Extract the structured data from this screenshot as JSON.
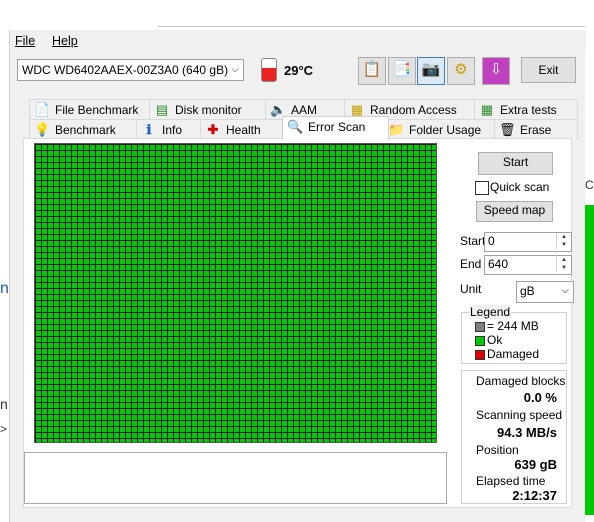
{
  "menu": {
    "file": "File",
    "help": "Help"
  },
  "toolbar": {
    "drive": "WDC WD6402AAEX-00Z3A0 (640 gB)",
    "temperature": "29°C",
    "exit_label": "Exit",
    "buttons": [
      "copy-icon",
      "save-text-icon",
      "camera-icon",
      "tools-icon",
      "download-icon"
    ]
  },
  "tabs_row1": [
    {
      "label": "File Benchmark",
      "icon": "file-info-icon"
    },
    {
      "label": "Disk monitor",
      "icon": "chart-icon"
    },
    {
      "label": "AAM",
      "icon": "speaker-icon"
    },
    {
      "label": "Random Access",
      "icon": "random-grid-icon"
    },
    {
      "label": "Extra tests",
      "icon": "table-icon"
    }
  ],
  "tabs_row2": [
    {
      "label": "Benchmark",
      "icon": "bulb-icon"
    },
    {
      "label": "Info",
      "icon": "info-icon"
    },
    {
      "label": "Health",
      "icon": "health-cross-icon"
    },
    {
      "label": "Error Scan",
      "icon": "magnifier-icon"
    },
    {
      "label": "Folder Usage",
      "icon": "folder-icon"
    },
    {
      "label": "Erase",
      "icon": "trash-icon"
    }
  ],
  "scan": {
    "start_button": "Start",
    "quick_scan_label": "Quick scan",
    "quick_scan_checked": false,
    "speed_map_button": "Speed map",
    "start_label": "Start",
    "start_value": "0",
    "end_label": "End",
    "end_value": "640",
    "unit_label": "Unit",
    "unit_value": "gB",
    "legend": {
      "title": "Legend",
      "block_size": "= 244 MB",
      "ok": "Ok",
      "damaged": "Damaged",
      "ok_color": "#00c800",
      "damaged_color": "#e00000",
      "block_color": "#808080"
    },
    "stats": {
      "damaged_label": "Damaged blocks",
      "damaged_value": "0.0 %",
      "speed_label": "Scanning speed",
      "speed_value": "94.3 MB/s",
      "position_label": "Position",
      "position_value": "639 gB",
      "elapsed_label": "Elapsed time",
      "elapsed_value": "2:12:37"
    }
  },
  "background": {
    "fragment_1": "n",
    "fragment_2": "n:",
    "fragment_3": ">",
    "fragment_4": "C"
  }
}
